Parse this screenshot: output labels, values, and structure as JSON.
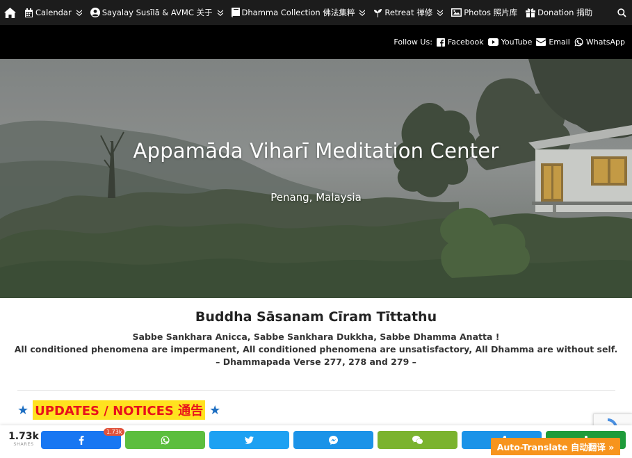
{
  "nav": {
    "items": [
      {
        "label": "Calendar",
        "icon": "calendar-icon"
      },
      {
        "label": "Sayalay Susīlā & AVMC 关于",
        "icon": "user-circle-icon"
      },
      {
        "label": "Dhamma Collection 佛法集粹",
        "icon": "book-icon"
      },
      {
        "label": "Retreat 禅修",
        "icon": "seedling-icon"
      },
      {
        "label": "Photos 照片库",
        "icon": "image-icon"
      },
      {
        "label": "Donation 捐助",
        "icon": "gift-icon"
      }
    ]
  },
  "follow": {
    "label": "Follow Us:",
    "links": [
      {
        "label": "Facebook",
        "icon": "facebook-icon"
      },
      {
        "label": "YouTube",
        "icon": "youtube-icon"
      },
      {
        "label": "Email",
        "icon": "envelope-icon"
      },
      {
        "label": "WhatsApp",
        "icon": "whatsapp-icon"
      }
    ]
  },
  "hero": {
    "title": "Appamāda Viharī Meditation Center",
    "subtitle": "Penang, Malaysia"
  },
  "quote": {
    "title": "Buddha Sāsanam Cīram Tīttathu",
    "line1": "Sabbe Sankhara Anicca, Sabbe Sankhara Dukkha, Sabbe Dhamma Anatta !",
    "line2": "All conditioned phenomena are impermanent, All conditioned phenomena are unsatisfactory, All Dhamma are without self.",
    "line3": "– Dhammapada Verse 277, 278 and 279 –"
  },
  "updates": {
    "star": "★",
    "label": "UPDATES / NOTICES 通告"
  },
  "share": {
    "count": "1.73k",
    "count_label": "SHARES",
    "badge": "1.73k",
    "buttons": [
      {
        "name": "facebook",
        "color": "#1877f2"
      },
      {
        "name": "whatsapp",
        "color": "#5cbe3e"
      },
      {
        "name": "twitter",
        "color": "#1da1f2"
      },
      {
        "name": "messenger",
        "color": "#1b93e8"
      },
      {
        "name": "wechat",
        "color": "#7bb32e"
      },
      {
        "name": "more",
        "color": "#1b93e8"
      },
      {
        "name": "sharethis",
        "color": "#1e9b3a"
      }
    ]
  },
  "translate": {
    "label": "Auto-Translate 自动翻译 »"
  }
}
